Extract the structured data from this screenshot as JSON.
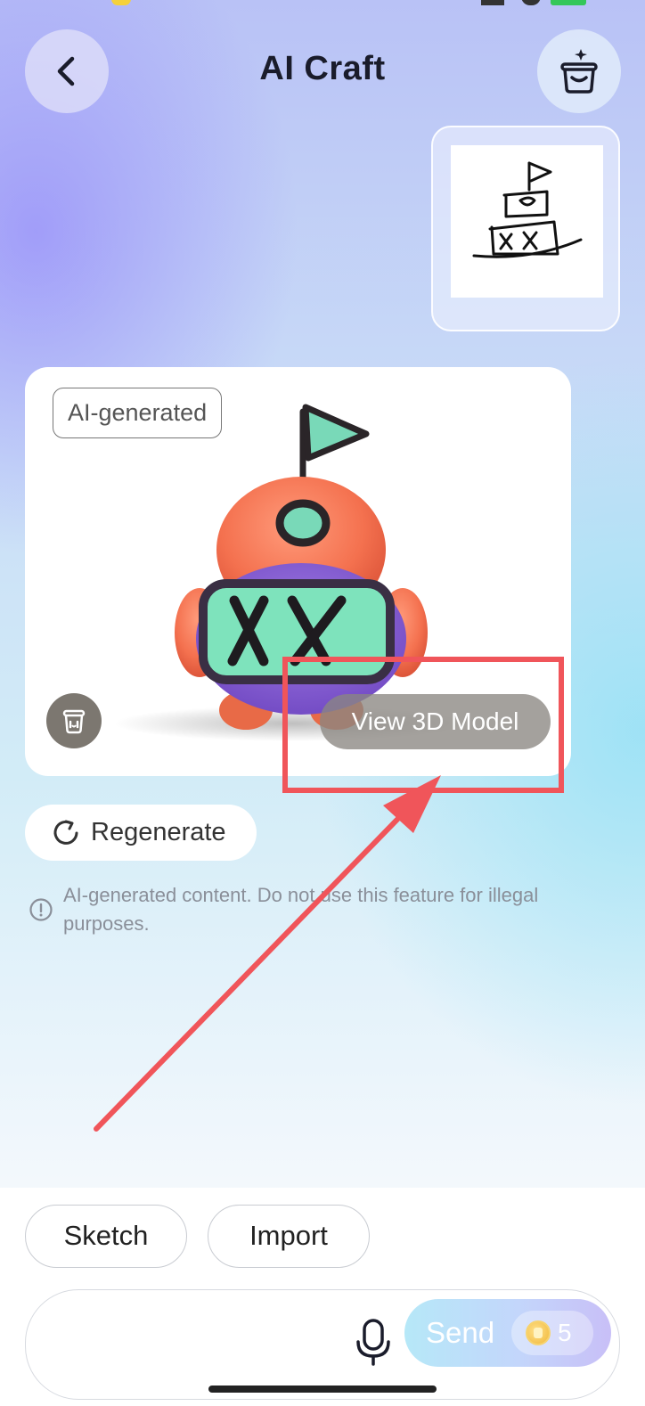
{
  "header": {
    "title": "AI Craft",
    "back_icon": "chevron-left-icon",
    "right_icon": "basket-sparkle-icon"
  },
  "sketch": {
    "image_icon": "castle-sketch"
  },
  "result": {
    "badge": "AI-generated",
    "view_3d_label": "View 3D Model",
    "delete_icon": "trash-icon"
  },
  "regenerate": {
    "label": "Regenerate",
    "icon": "refresh-icon"
  },
  "disclaimer": {
    "icon": "info-circle-icon",
    "text": "AI-generated content. Do not use this feature for illegal purposes."
  },
  "bottom": {
    "sketch_label": "Sketch",
    "import_label": "Import",
    "input_placeholder": "",
    "mic_icon": "microphone-icon",
    "send_label": "Send",
    "credits": "5"
  },
  "colors": {
    "annotation_red": "#f0555a",
    "title": "#1a1c2b",
    "figure_body": "#f4714f",
    "figure_screen": "#7ee3bc",
    "figure_belly": "#8f66d8"
  }
}
